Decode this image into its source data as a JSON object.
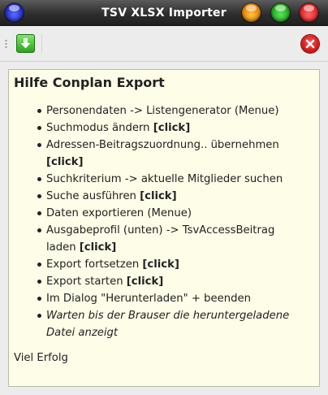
{
  "window": {
    "title": "TSV XLSX Importer"
  },
  "toolbar": {
    "import_icon": "download-arrow-icon",
    "close_icon": "red-close-icon"
  },
  "help": {
    "heading": "Hilfe Conplan Export",
    "steps": [
      {
        "text": "Personendaten -> Listengenerator (Menue)",
        "action": ""
      },
      {
        "text": "Suchmodus ändern ",
        "action": "[click]"
      },
      {
        "text": "Adressen-Beitragszuordnung.. übernehmen ",
        "action": "[click]"
      },
      {
        "text": "Suchkriterium -> aktuelle Mitglieder suchen",
        "action": ""
      },
      {
        "text": "Suche ausführen ",
        "action": "[click]"
      },
      {
        "text": "Daten exportieren (Menue)",
        "action": ""
      },
      {
        "text": "Ausgabeprofil (unten) -> TsvAccessBeitrag laden ",
        "action": "[click]"
      },
      {
        "text": "Export fortsetzen ",
        "action": "[click]"
      },
      {
        "text": "Export starten ",
        "action": "[click]"
      },
      {
        "text": "Im Dialog \"Herunterladen\" + beenden",
        "action": ""
      },
      {
        "text": "Warten bis der Brauser die heruntergeladene Datei anzeigt",
        "action": ""
      }
    ],
    "closing": "Viel Erfolg"
  }
}
